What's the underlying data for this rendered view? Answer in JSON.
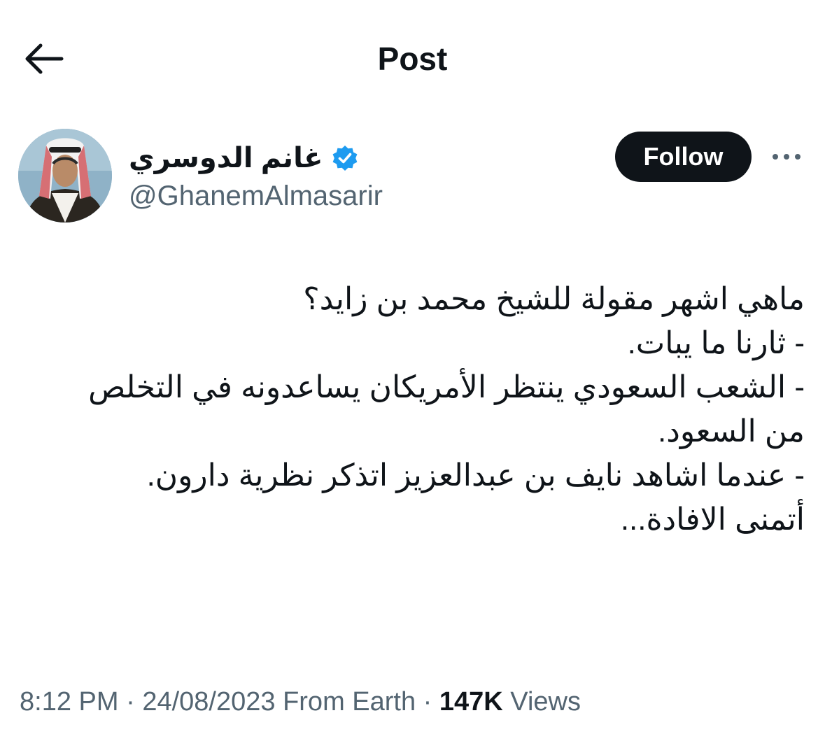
{
  "header": {
    "title": "Post",
    "back_icon": "arrow-left-icon"
  },
  "author": {
    "display_name": "غانم الدوسري",
    "handle": "@GhanemAlmasarir",
    "verified": true,
    "verified_color": "#1d9bf0"
  },
  "actions": {
    "follow_label": "Follow",
    "more_icon": "more-horizontal-icon"
  },
  "tweet": {
    "lines": [
      "ماهي اشهر مقولة للشيخ محمد بن زايد؟",
      "- ثارنا ما يبات.",
      "- الشعب السعودي ينتظر الأمريكان يساعدونه في التخلص",
      "من السعود.",
      "- عندما اشاهد نايف بن عبدالعزيز اتذكر نظرية دارون.",
      "أتمنى الافادة..."
    ]
  },
  "meta": {
    "time": "8:12 PM",
    "date": "24/08/2023",
    "source": "From Earth",
    "views_count": "147K",
    "views_label": "Views"
  },
  "colors": {
    "text": "#0f1419",
    "secondary": "#536471",
    "follow_bg": "#0f1419",
    "follow_text": "#ffffff"
  }
}
